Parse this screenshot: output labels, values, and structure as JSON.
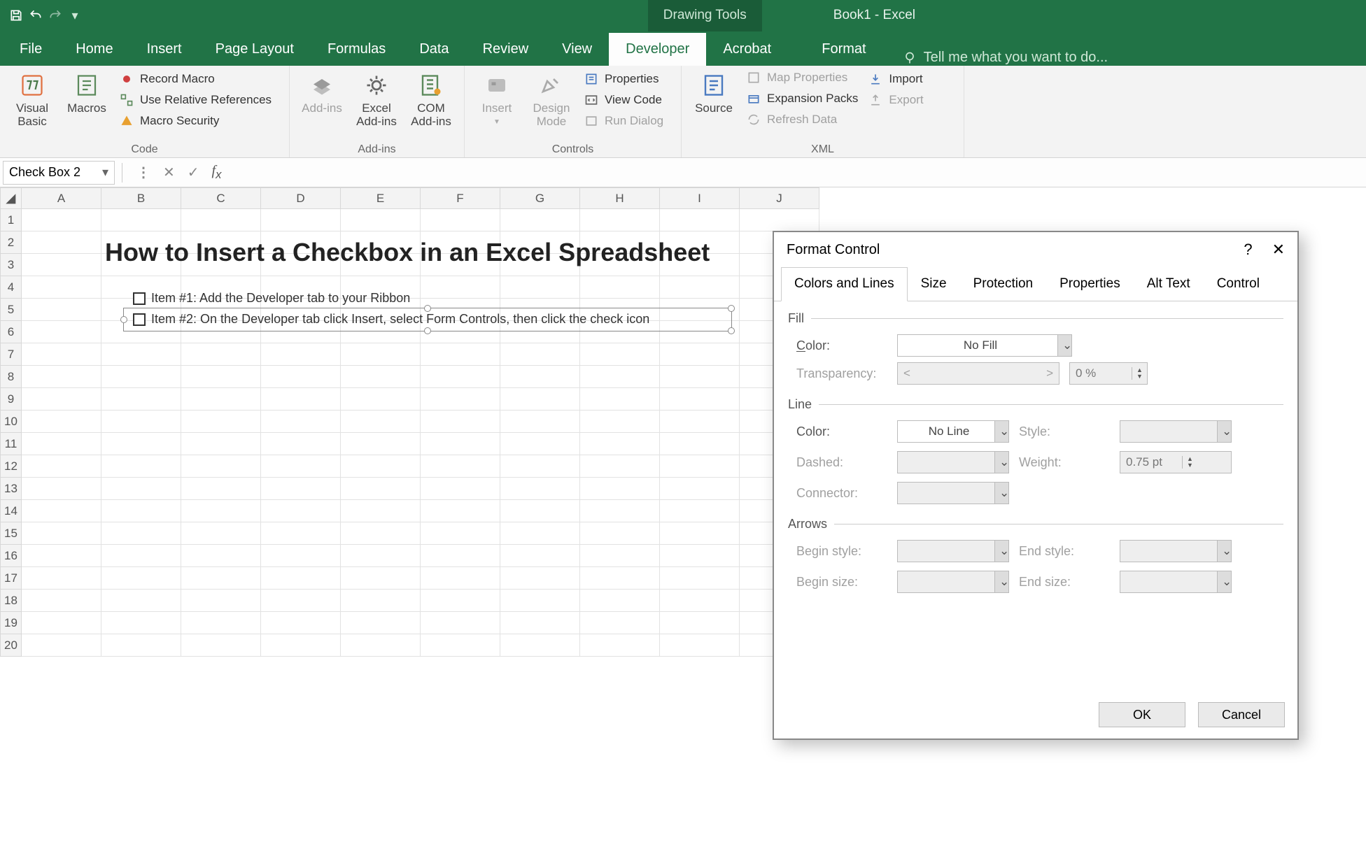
{
  "titlebar": {
    "context_tab": "Drawing Tools",
    "title": "Book1 - Excel"
  },
  "ribbon_tabs": [
    "File",
    "Home",
    "Insert",
    "Page Layout",
    "Formulas",
    "Data",
    "Review",
    "View",
    "Developer",
    "Acrobat",
    "Format"
  ],
  "active_tab": "Developer",
  "tellme": "Tell me what you want to do...",
  "ribbon": {
    "code": {
      "label": "Code",
      "visual_basic": "Visual Basic",
      "macros": "Macros",
      "record_macro": "Record Macro",
      "use_rel": "Use Relative References",
      "macro_security": "Macro Security"
    },
    "addins": {
      "label": "Add-ins",
      "addins": "Add-ins",
      "excel_addins": "Excel Add-ins",
      "com_addins": "COM Add-ins"
    },
    "controls": {
      "label": "Controls",
      "insert": "Insert",
      "design_mode": "Design Mode",
      "properties": "Properties",
      "view_code": "View Code",
      "run_dialog": "Run Dialog"
    },
    "xml": {
      "label": "XML",
      "source": "Source",
      "map_properties": "Map Properties",
      "expansion_packs": "Expansion Packs",
      "refresh_data": "Refresh Data",
      "import": "Import",
      "export": "Export"
    }
  },
  "formula_bar": {
    "name": "Check Box 2",
    "formula": ""
  },
  "columns": [
    "A",
    "B",
    "C",
    "D",
    "E",
    "F",
    "G",
    "H",
    "I",
    "J"
  ],
  "rows_count": 20,
  "sheet": {
    "title": "How to Insert a Checkbox in an Excel Spreadsheet",
    "item1": "Item #1: Add the Developer tab to your Ribbon",
    "item2": "Item #2: On the Developer tab click Insert, select Form Controls, then click the check icon"
  },
  "dialog": {
    "title": "Format Control",
    "tabs": [
      "Colors and Lines",
      "Size",
      "Protection",
      "Properties",
      "Alt Text",
      "Control"
    ],
    "active_tab": "Colors and Lines",
    "fill": {
      "legend": "Fill",
      "color_label": "Color:",
      "color_value": "No Fill",
      "transparency_label": "Transparency:",
      "transparency_value": "0 %"
    },
    "line": {
      "legend": "Line",
      "color_label": "Color:",
      "color_value": "No Line",
      "style_label": "Style:",
      "dashed_label": "Dashed:",
      "weight_label": "Weight:",
      "weight_value": "0.75 pt",
      "connector_label": "Connector:"
    },
    "arrows": {
      "legend": "Arrows",
      "begin_style": "Begin style:",
      "end_style": "End style:",
      "begin_size": "Begin size:",
      "end_size": "End size:"
    },
    "ok": "OK",
    "cancel": "Cancel"
  }
}
